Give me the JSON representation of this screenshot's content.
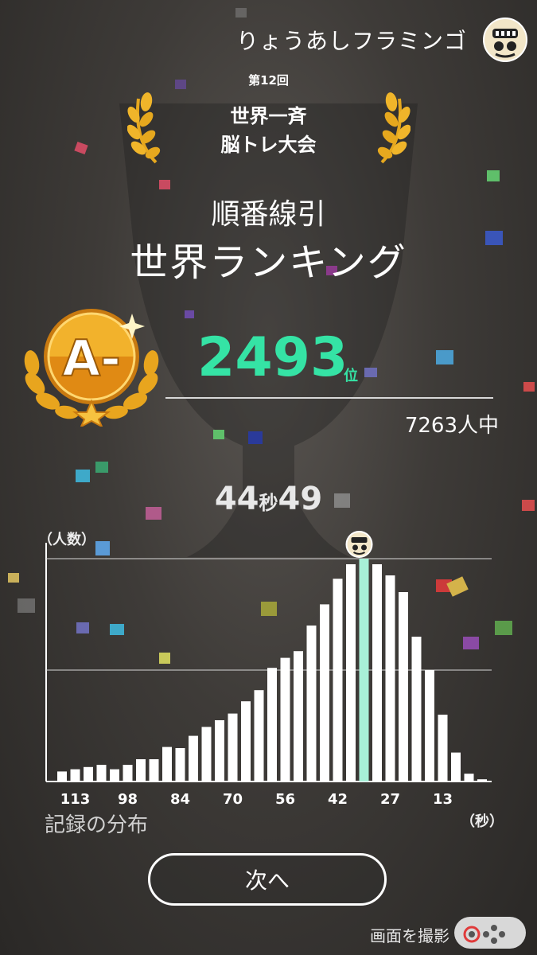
{
  "header": {
    "player_name": "りょうあしフラミンゴ",
    "avatar_icon": "face-avatar-icon"
  },
  "event": {
    "edition": "第12回",
    "title_line1": "世界一斉",
    "title_line2": "脳トレ大会"
  },
  "game": {
    "name": "順番線引",
    "ranking_title": "世界ランキング"
  },
  "result": {
    "grade": "A-",
    "rank": "2493",
    "rank_unit": "位",
    "total_players": "7263人中",
    "time_seconds": "44",
    "time_seconds_unit": "秒",
    "time_hundredths": "49"
  },
  "colors": {
    "accent": "#35e3a5",
    "gold": "#f0a418",
    "bar": "#ffffff",
    "bar_highlight": "#a8f0d8"
  },
  "chart_data": {
    "type": "bar",
    "title": "",
    "ylabel": "（人数）",
    "xlabel": "（秒）",
    "x_tick_labels": [
      "113",
      "98",
      "84",
      "70",
      "56",
      "42",
      "27",
      "13"
    ],
    "values": [
      9,
      11,
      13,
      15,
      11,
      15,
      20,
      20,
      31,
      30,
      41,
      49,
      55,
      61,
      72,
      82,
      102,
      111,
      117,
      140,
      159,
      182,
      195,
      200,
      195,
      185,
      170,
      130,
      100,
      60,
      26,
      7,
      2
    ],
    "highlight_index": 23,
    "ylim": [
      0,
      200
    ],
    "grid": true,
    "highlight_label": "player-marker"
  },
  "distribution_label": "記録の分布",
  "buttons": {
    "next": "次へ",
    "capture": "画面を撮影"
  }
}
